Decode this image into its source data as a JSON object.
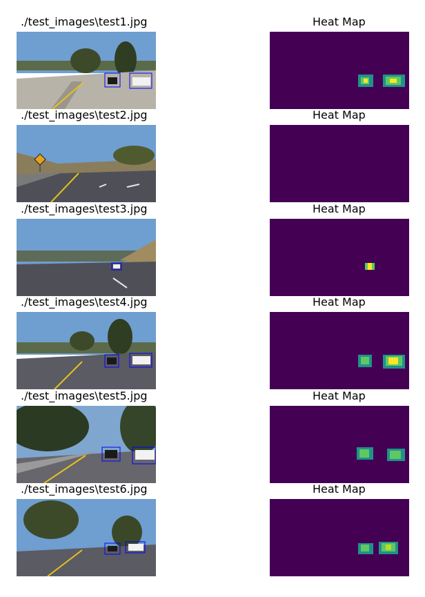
{
  "rows": [
    {
      "left_title": "./test_images\\test1.jpg",
      "right_title": "Heat Map"
    },
    {
      "left_title": "./test_images\\test2.jpg",
      "right_title": "Heat Map"
    },
    {
      "left_title": "./test_images\\test3.jpg",
      "right_title": "Heat Map"
    },
    {
      "left_title": "./test_images\\test4.jpg",
      "right_title": "Heat Map"
    },
    {
      "left_title": "./test_images\\test5.jpg",
      "right_title": "Heat Map"
    },
    {
      "left_title": "./test_images\\test6.jpg",
      "right_title": "Heat Map"
    }
  ],
  "colors": {
    "heatmap_background": "#440154",
    "box_outline": "#0000ff",
    "sky": "#6f9ed0",
    "road": "#5d5d64",
    "lane_yellow": "#e6c21c"
  }
}
